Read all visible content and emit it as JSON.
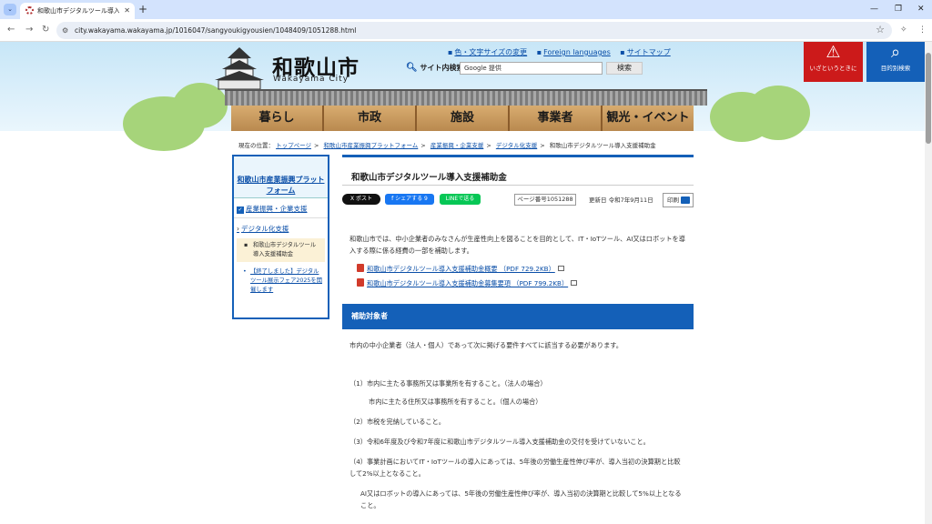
{
  "browser": {
    "tab_title": "和歌山市デジタルツール導入支援補助",
    "url": "city.wakayama.wakayama.jp/1016047/sangyoukigyousien/1048409/1051288.html"
  },
  "header": {
    "logo_jp": "和歌山市",
    "logo_en": "Wakayama City",
    "util_links": [
      "色・文字サイズの変更",
      "Foreign languages",
      "サイトマップ"
    ],
    "search_label": "サイト内検索",
    "search_placeholder": "Google 提供",
    "search_button": "検索",
    "emergency_label": "いざというときに",
    "purpose_label": "目的別検索"
  },
  "nav": [
    "暮らし",
    "市政",
    "施設",
    "事業者",
    "観光・イベント"
  ],
  "breadcrumb": {
    "prefix": "現在の位置：",
    "links": [
      "トップページ",
      "和歌山市産業振興プラットフォーム",
      "産業振興・企業支援",
      "デジタル化支援"
    ],
    "current": "和歌山市デジタルツール導入支援補助金"
  },
  "sidebar": {
    "title": "和歌山市産業振興プラットフォーム",
    "category": "産業振興・企業支援",
    "subcategory": "デジタル化支援",
    "current": "和歌山市デジタルツール導入支援補助金",
    "other": "【終了しました】デジタルツール展示フェア2025を開催します"
  },
  "main": {
    "title": "和歌山市デジタルツール導入支援補助金",
    "share_x": "X ポスト",
    "share_fb": "f シェアする 9",
    "share_line": "LINEで送る",
    "page_number": "ページ番号1051288",
    "updated": "更新日 令和7年9月11日",
    "print": "印刷",
    "intro": "和歌山市では、中小企業者のみなさんが生産性向上を図ることを目的として、IT・IoTツール、AI又はロボットを導入する際に係る経費の一部を補助します。",
    "pdfs": [
      "和歌山市デジタルツール導入支援補助金概要 （PDF 729.2KB）",
      "和歌山市デジタルツール導入支援補助金募集要項 （PDF 799.2KB）"
    ],
    "section_title": "補助対象者",
    "lead": "市内の中小企業者（法人・個人）であって次に掲げる要件すべてに該当する必要があります。",
    "req1": "（1）市内に主たる事務所又は事業所を有すること。（法人の場合）",
    "req1b": "市内に主たる住所又は事務所を有すること。（個人の場合）",
    "req2": "（2）市税を完納していること。",
    "req3": "（3）令和6年度及び令和7年度に和歌山市デジタルツール導入支援補助金の交付を受けていないこと。",
    "req4": "（4）事業計画においてIT・IoTツールの導入にあっては、5年後の労働生産性伸び率が、導入当初の決算期と比較して2%以上となること。",
    "req4b": "AI又はロボットの導入にあっては、5年後の労働生産性伸び率が、導入当初の決算期と比較して5%以上となること。"
  }
}
